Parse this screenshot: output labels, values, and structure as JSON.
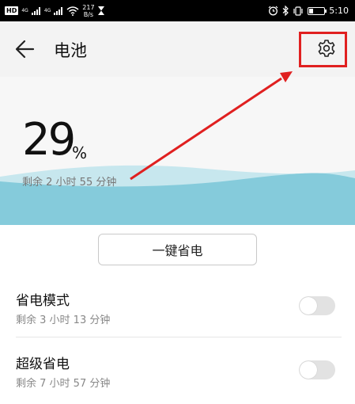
{
  "status_bar": {
    "hd": "HD",
    "net1": "4G",
    "net2": "4G",
    "speed_value": "217",
    "speed_unit": "B/s",
    "time": "5:10",
    "battery_level": 0.29
  },
  "header": {
    "title": "电池",
    "back_icon": "arrow-left-icon",
    "settings_icon": "gear-icon"
  },
  "battery": {
    "percent": "29",
    "percent_sign": "%",
    "remaining": "剩余 2 小时 55 分钟"
  },
  "actions": {
    "one_key_save": "一键省电"
  },
  "modes": [
    {
      "title": "省电模式",
      "remaining": "剩余 3 小时 13 分钟",
      "enabled": false
    },
    {
      "title": "超级省电",
      "remaining": "剩余 7 小时 57 分钟",
      "enabled": false
    }
  ],
  "colors": {
    "wave": "#7cc8d8",
    "wave_light": "#b9e2ea",
    "annotation": "#e02020",
    "toggle_off": "#e2e2e2"
  }
}
